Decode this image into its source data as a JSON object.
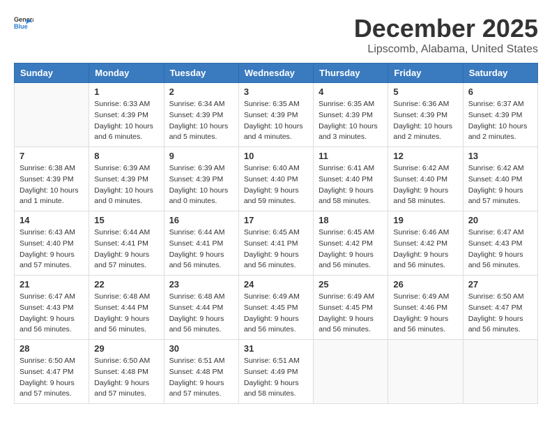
{
  "header": {
    "logo_general": "General",
    "logo_blue": "Blue",
    "month": "December 2025",
    "location": "Lipscomb, Alabama, United States"
  },
  "weekdays": [
    "Sunday",
    "Monday",
    "Tuesday",
    "Wednesday",
    "Thursday",
    "Friday",
    "Saturday"
  ],
  "weeks": [
    [
      {
        "day": "",
        "info": ""
      },
      {
        "day": "1",
        "info": "Sunrise: 6:33 AM\nSunset: 4:39 PM\nDaylight: 10 hours\nand 6 minutes."
      },
      {
        "day": "2",
        "info": "Sunrise: 6:34 AM\nSunset: 4:39 PM\nDaylight: 10 hours\nand 5 minutes."
      },
      {
        "day": "3",
        "info": "Sunrise: 6:35 AM\nSunset: 4:39 PM\nDaylight: 10 hours\nand 4 minutes."
      },
      {
        "day": "4",
        "info": "Sunrise: 6:35 AM\nSunset: 4:39 PM\nDaylight: 10 hours\nand 3 minutes."
      },
      {
        "day": "5",
        "info": "Sunrise: 6:36 AM\nSunset: 4:39 PM\nDaylight: 10 hours\nand 2 minutes."
      },
      {
        "day": "6",
        "info": "Sunrise: 6:37 AM\nSunset: 4:39 PM\nDaylight: 10 hours\nand 2 minutes."
      }
    ],
    [
      {
        "day": "7",
        "info": "Sunrise: 6:38 AM\nSunset: 4:39 PM\nDaylight: 10 hours\nand 1 minute."
      },
      {
        "day": "8",
        "info": "Sunrise: 6:39 AM\nSunset: 4:39 PM\nDaylight: 10 hours\nand 0 minutes."
      },
      {
        "day": "9",
        "info": "Sunrise: 6:39 AM\nSunset: 4:39 PM\nDaylight: 10 hours\nand 0 minutes."
      },
      {
        "day": "10",
        "info": "Sunrise: 6:40 AM\nSunset: 4:40 PM\nDaylight: 9 hours\nand 59 minutes."
      },
      {
        "day": "11",
        "info": "Sunrise: 6:41 AM\nSunset: 4:40 PM\nDaylight: 9 hours\nand 58 minutes."
      },
      {
        "day": "12",
        "info": "Sunrise: 6:42 AM\nSunset: 4:40 PM\nDaylight: 9 hours\nand 58 minutes."
      },
      {
        "day": "13",
        "info": "Sunrise: 6:42 AM\nSunset: 4:40 PM\nDaylight: 9 hours\nand 57 minutes."
      }
    ],
    [
      {
        "day": "14",
        "info": "Sunrise: 6:43 AM\nSunset: 4:40 PM\nDaylight: 9 hours\nand 57 minutes."
      },
      {
        "day": "15",
        "info": "Sunrise: 6:44 AM\nSunset: 4:41 PM\nDaylight: 9 hours\nand 57 minutes."
      },
      {
        "day": "16",
        "info": "Sunrise: 6:44 AM\nSunset: 4:41 PM\nDaylight: 9 hours\nand 56 minutes."
      },
      {
        "day": "17",
        "info": "Sunrise: 6:45 AM\nSunset: 4:41 PM\nDaylight: 9 hours\nand 56 minutes."
      },
      {
        "day": "18",
        "info": "Sunrise: 6:45 AM\nSunset: 4:42 PM\nDaylight: 9 hours\nand 56 minutes."
      },
      {
        "day": "19",
        "info": "Sunrise: 6:46 AM\nSunset: 4:42 PM\nDaylight: 9 hours\nand 56 minutes."
      },
      {
        "day": "20",
        "info": "Sunrise: 6:47 AM\nSunset: 4:43 PM\nDaylight: 9 hours\nand 56 minutes."
      }
    ],
    [
      {
        "day": "21",
        "info": "Sunrise: 6:47 AM\nSunset: 4:43 PM\nDaylight: 9 hours\nand 56 minutes."
      },
      {
        "day": "22",
        "info": "Sunrise: 6:48 AM\nSunset: 4:44 PM\nDaylight: 9 hours\nand 56 minutes."
      },
      {
        "day": "23",
        "info": "Sunrise: 6:48 AM\nSunset: 4:44 PM\nDaylight: 9 hours\nand 56 minutes."
      },
      {
        "day": "24",
        "info": "Sunrise: 6:49 AM\nSunset: 4:45 PM\nDaylight: 9 hours\nand 56 minutes."
      },
      {
        "day": "25",
        "info": "Sunrise: 6:49 AM\nSunset: 4:45 PM\nDaylight: 9 hours\nand 56 minutes."
      },
      {
        "day": "26",
        "info": "Sunrise: 6:49 AM\nSunset: 4:46 PM\nDaylight: 9 hours\nand 56 minutes."
      },
      {
        "day": "27",
        "info": "Sunrise: 6:50 AM\nSunset: 4:47 PM\nDaylight: 9 hours\nand 56 minutes."
      }
    ],
    [
      {
        "day": "28",
        "info": "Sunrise: 6:50 AM\nSunset: 4:47 PM\nDaylight: 9 hours\nand 57 minutes."
      },
      {
        "day": "29",
        "info": "Sunrise: 6:50 AM\nSunset: 4:48 PM\nDaylight: 9 hours\nand 57 minutes."
      },
      {
        "day": "30",
        "info": "Sunrise: 6:51 AM\nSunset: 4:48 PM\nDaylight: 9 hours\nand 57 minutes."
      },
      {
        "day": "31",
        "info": "Sunrise: 6:51 AM\nSunset: 4:49 PM\nDaylight: 9 hours\nand 58 minutes."
      },
      {
        "day": "",
        "info": ""
      },
      {
        "day": "",
        "info": ""
      },
      {
        "day": "",
        "info": ""
      }
    ]
  ]
}
